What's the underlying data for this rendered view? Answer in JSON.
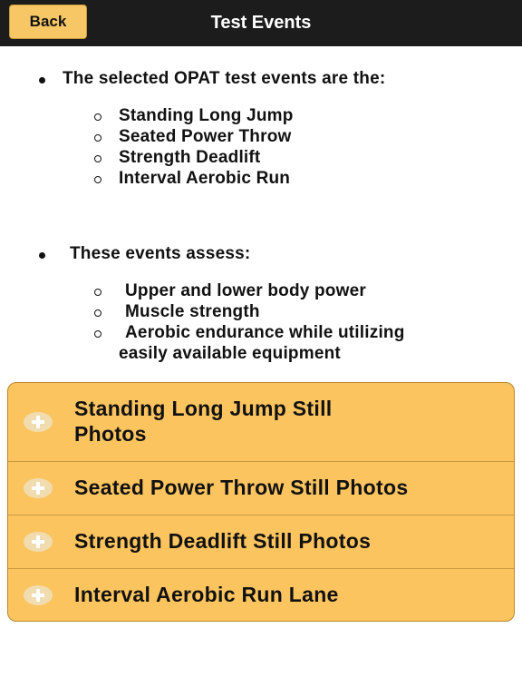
{
  "navbar": {
    "back_label": "Back",
    "title": "Test Events"
  },
  "intro": {
    "heading": "The selected OPAT test events are the:",
    "events": [
      "Standing Long Jump",
      "Seated Power Throw",
      "Strength Deadlift",
      "Interval Aerobic Run"
    ]
  },
  "assess": {
    "heading": "These events assess:",
    "items": [
      "Upper and lower body power",
      "Muscle strength",
      "Aerobic endurance while utilizing",
      "easily available equipment"
    ]
  },
  "accordion": {
    "items": [
      {
        "line1": "Standing Long Jump Still",
        "line2": "Photos"
      },
      {
        "line1": "Seated Power Throw Still Photos"
      },
      {
        "line1": "Strength Deadlift Still Photos"
      },
      {
        "line1": "Interval Aerobic Run Lane"
      }
    ]
  },
  "colors": {
    "navbar_bg": "#1c1c1c",
    "accent": "#fbc45f",
    "back_button": "#f7c766"
  },
  "icons": [
    "plus-icon"
  ]
}
